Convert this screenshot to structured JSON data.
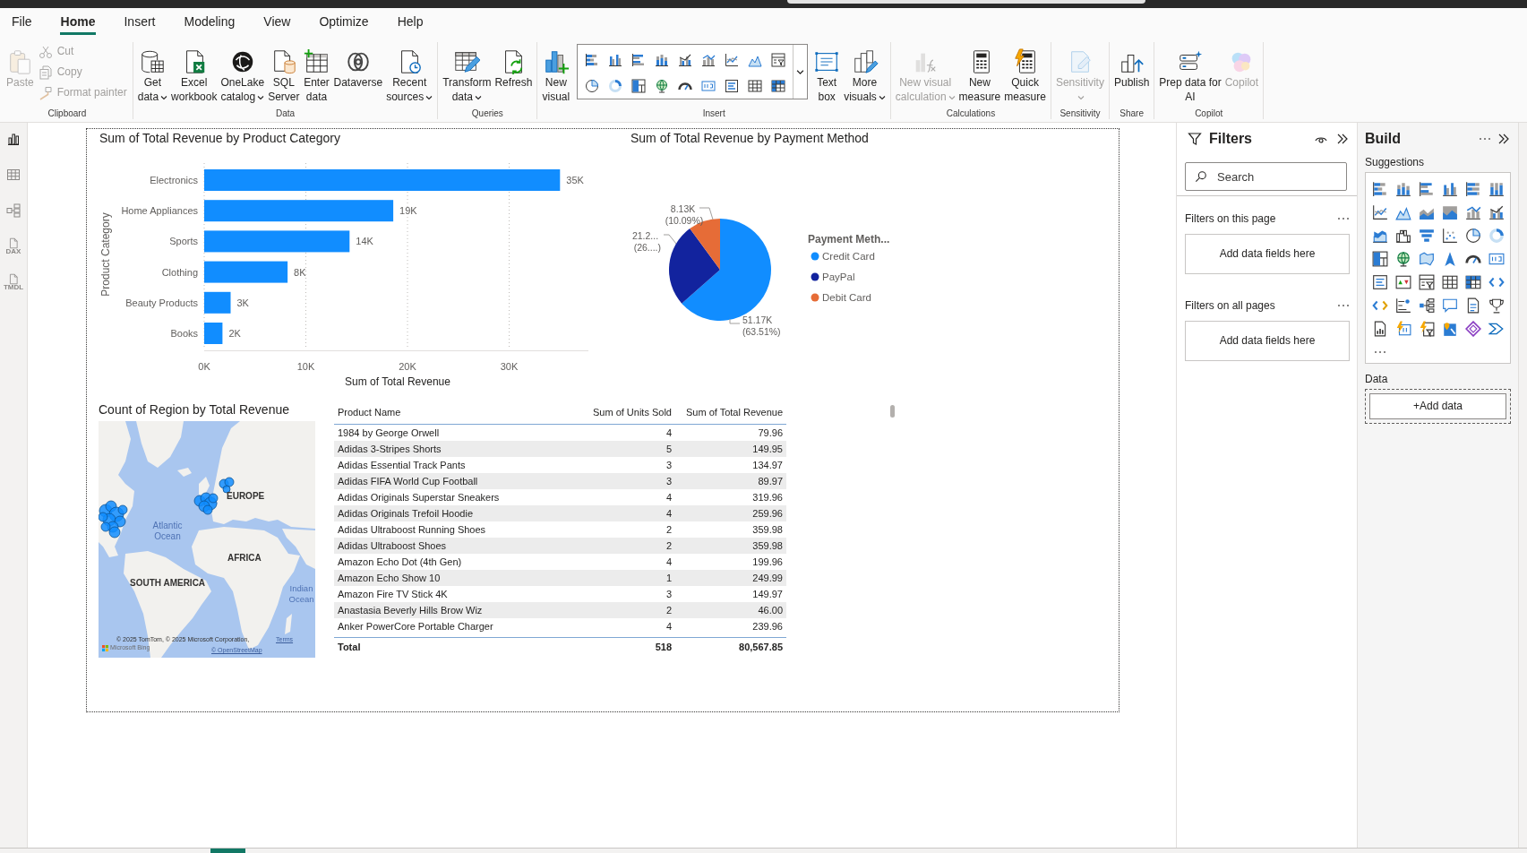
{
  "menu_tabs": [
    {
      "label": "File",
      "selected": false
    },
    {
      "label": "Home",
      "selected": true
    },
    {
      "label": "Insert",
      "selected": false
    },
    {
      "label": "Modeling",
      "selected": false
    },
    {
      "label": "View",
      "selected": false
    },
    {
      "label": "Optimize",
      "selected": false
    },
    {
      "label": "Help",
      "selected": false
    }
  ],
  "ribbon": [
    {
      "label": "Clipboard",
      "items": [
        {
          "kind": "large",
          "lines": [
            "Paste"
          ],
          "disabled": true,
          "dropdown": false
        },
        {
          "kind": "small",
          "lines": [
            "Cut"
          ],
          "disabled": true,
          "dropdown": false
        },
        {
          "kind": "small",
          "lines": [
            "Copy"
          ],
          "disabled": true,
          "dropdown": false
        },
        {
          "kind": "small",
          "lines": [
            "Format painter"
          ],
          "disabled": true,
          "dropdown": false
        }
      ]
    },
    {
      "label": "Data",
      "items": [
        {
          "kind": "large",
          "lines": [
            "Get",
            "data"
          ],
          "disabled": false,
          "dropdown": true
        },
        {
          "kind": "large",
          "lines": [
            "Excel",
            "workbook"
          ],
          "disabled": false,
          "dropdown": false
        },
        {
          "kind": "large",
          "lines": [
            "OneLake",
            "catalog"
          ],
          "disabled": false,
          "dropdown": true
        },
        {
          "kind": "large",
          "lines": [
            "SQL",
            "Server"
          ],
          "disabled": false,
          "dropdown": false
        },
        {
          "kind": "large",
          "lines": [
            "Enter",
            "data"
          ],
          "disabled": false,
          "dropdown": false
        },
        {
          "kind": "large",
          "lines": [
            "Dataverse"
          ],
          "disabled": false,
          "dropdown": false
        },
        {
          "kind": "large",
          "lines": [
            "Recent",
            "sources"
          ],
          "disabled": false,
          "dropdown": true
        }
      ]
    },
    {
      "label": "Queries",
      "items": [
        {
          "kind": "large",
          "lines": [
            "Transform",
            "data"
          ],
          "disabled": false,
          "dropdown": true
        },
        {
          "kind": "large",
          "lines": [
            "Refresh"
          ],
          "disabled": false,
          "dropdown": false
        }
      ]
    },
    {
      "label": "Insert",
      "items": [
        {
          "kind": "large",
          "lines": [
            "New",
            "visual"
          ],
          "disabled": false,
          "dropdown": false
        },
        {
          "kind": "gallery"
        },
        {
          "kind": "large",
          "lines": [
            "Text",
            "box"
          ],
          "disabled": false,
          "dropdown": false
        },
        {
          "kind": "large",
          "lines": [
            "More",
            "visuals"
          ],
          "disabled": false,
          "dropdown": true
        }
      ]
    },
    {
      "label": "Calculations",
      "items": [
        {
          "kind": "large",
          "lines": [
            "New visual",
            "calculation"
          ],
          "disabled": true,
          "dropdown": true
        },
        {
          "kind": "large",
          "lines": [
            "New",
            "measure"
          ],
          "disabled": false,
          "dropdown": false
        },
        {
          "kind": "large",
          "lines": [
            "Quick",
            "measure"
          ],
          "disabled": false,
          "dropdown": false
        }
      ]
    },
    {
      "label": "Sensitivity",
      "items": [
        {
          "kind": "large",
          "lines": [
            "Sensitivity"
          ],
          "disabled": true,
          "dropdown": true
        }
      ]
    },
    {
      "label": "Share",
      "items": [
        {
          "kind": "large",
          "lines": [
            "Publish"
          ],
          "disabled": false,
          "dropdown": false
        }
      ]
    },
    {
      "label": "Copilot",
      "items": [
        {
          "kind": "large",
          "lines": [
            "Prep data for",
            "AI"
          ],
          "disabled": false,
          "dropdown": false
        },
        {
          "kind": "large",
          "lines": [
            "Copilot"
          ],
          "disabled": true,
          "dropdown": false
        }
      ]
    }
  ],
  "view_rail": [
    {
      "selected": true
    },
    {
      "selected": false
    },
    {
      "selected": false
    },
    {
      "selected": false,
      "tag": "DAX"
    },
    {
      "selected": false,
      "tag": "TMDL"
    }
  ],
  "report": {
    "bar_chart": {
      "chart_data": {
        "type": "bar",
        "orientation": "horizontal",
        "title": "Sum of Total Revenue by Product Category",
        "xlabel": "Sum of Total Revenue",
        "ylabel": "Product Category",
        "categories": [
          "Electronics",
          "Home Appliances",
          "Sports",
          "Clothing",
          "Beauty Products",
          "Books"
        ],
        "values": [
          35000,
          18600,
          14300,
          8200,
          2600,
          1800
        ],
        "color": "#118dff",
        "xlim": [
          0,
          40000
        ],
        "xticks": [
          {
            "value": 0,
            "label": "0K"
          },
          {
            "value": 10000,
            "label": "10K"
          },
          {
            "value": 20000,
            "label": "20K"
          },
          {
            "value": 30000,
            "label": "30K"
          }
        ],
        "grid": true,
        "value_labels": [
          "35K",
          "19K",
          "14K",
          "8K",
          "3K",
          "2K"
        ]
      }
    },
    "pie_chart": {
      "chart_data": {
        "type": "pie",
        "title": "Sum of Total Revenue by Payment Method",
        "legend_title": "Payment Meth...",
        "legend": "right",
        "categories": [
          "Credit Card",
          "PayPal",
          "Debit Card"
        ],
        "values": [
          51170,
          21270,
          8130
        ],
        "colors": [
          "#118dff",
          "#12239e",
          "#e66c37"
        ],
        "value_labels": [
          "51.17K (63.51%)",
          null,
          "8.13K (10.09%)"
        ],
        "annotations": [
          "21.2... (26....)"
        ]
      }
    },
    "map": {
      "title": "Count of Region by Total Revenue",
      "place_labels": [
        "EUROPE",
        "Atlantic Ocean",
        "AFRICA",
        "SOUTH AMERICA",
        "Indian Ocean"
      ],
      "attribution": "© 2025 TomTom, © 2025 Microsoft Corporation,",
      "terms_link": "Terms",
      "provider": "Microsoft Bing",
      "osm_link": "© OpenStreetMap"
    },
    "table": {
      "columns": [
        "Product Name",
        "Sum of Units Sold",
        "Sum of Total Revenue"
      ],
      "rows": [
        [
          "1984 by George Orwell",
          "4",
          "79.96"
        ],
        [
          "Adidas 3-Stripes Shorts",
          "5",
          "149.95"
        ],
        [
          "Adidas Essential Track Pants",
          "3",
          "134.97"
        ],
        [
          "Adidas FIFA World Cup Football",
          "3",
          "89.97"
        ],
        [
          "Adidas Originals Superstar Sneakers",
          "4",
          "319.96"
        ],
        [
          "Adidas Originals Trefoil Hoodie",
          "4",
          "259.96"
        ],
        [
          "Adidas Ultraboost Running Shoes",
          "2",
          "359.98"
        ],
        [
          "Adidas Ultraboost Shoes",
          "2",
          "359.98"
        ],
        [
          "Amazon Echo Dot (4th Gen)",
          "4",
          "199.96"
        ],
        [
          "Amazon Echo Show 10",
          "1",
          "249.99"
        ],
        [
          "Amazon Fire TV Stick 4K",
          "3",
          "149.97"
        ],
        [
          "Anastasia Beverly Hills Brow Wiz",
          "2",
          "46.00"
        ],
        [
          "Anker PowerCore Portable Charger",
          "4",
          "239.96"
        ]
      ],
      "total": [
        "Total",
        "518",
        "80,567.85"
      ]
    }
  },
  "filters_pane": {
    "title": "Filters",
    "search": {
      "placeholder": "Search"
    },
    "sections": [
      {
        "label": "Filters on this page",
        "drop_zone": "Add data fields here"
      },
      {
        "label": "Filters on all pages",
        "drop_zone": "Add data fields here"
      }
    ]
  },
  "build_pane": {
    "title": "Build",
    "suggestions_label": "Suggestions",
    "data_label": "Data",
    "add_data": "+Add data"
  }
}
